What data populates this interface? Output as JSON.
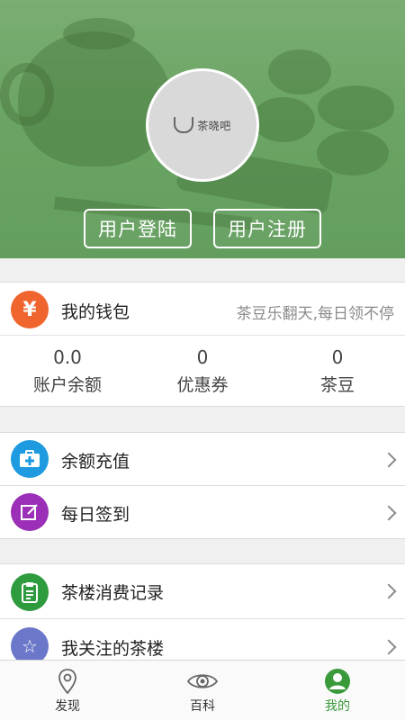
{
  "header": {
    "avatar_logo_text": "茶晓吧",
    "login_label": "用户登陆",
    "register_label": "用户注册"
  },
  "wallet": {
    "icon_symbol": "¥",
    "label": "我的钱包",
    "slogan": "茶豆乐翻天,每日领不停",
    "stats": [
      {
        "value": "0.0",
        "label": "账户余额"
      },
      {
        "value": "0",
        "label": "优惠券"
      },
      {
        "value": "0",
        "label": "茶豆"
      }
    ]
  },
  "menu": {
    "recharge_label": "余额充值",
    "signin_label": "每日签到",
    "records_label": "茶楼消费记录",
    "follow_label": "我关注的茶楼"
  },
  "nav": {
    "items": [
      {
        "label": "发现",
        "icon": "location-pin-icon"
      },
      {
        "label": "百科",
        "icon": "eye-icon"
      },
      {
        "label": "我的",
        "icon": "user-icon"
      }
    ],
    "active_index": 2
  },
  "colors": {
    "wallet_icon": "#f0642d",
    "recharge_icon": "#1e9be0",
    "signin_icon": "#9b2fb7",
    "records_icon": "#2e9b3e",
    "follow_icon": "#6b78c9",
    "nav_active": "#3a9a3a"
  }
}
